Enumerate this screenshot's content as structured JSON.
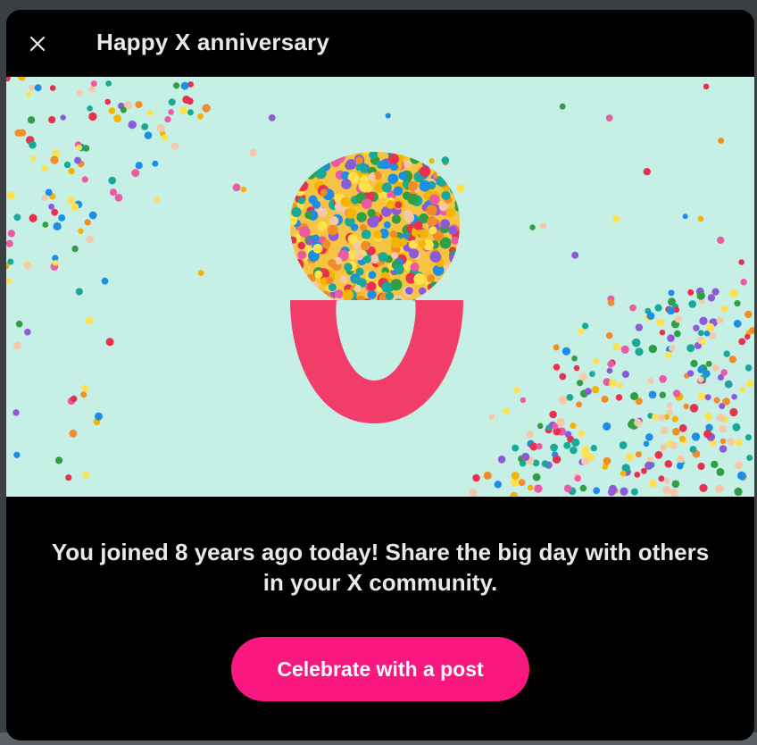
{
  "dialog": {
    "title": "Happy X anniversary",
    "close_icon": "close-icon",
    "message": "You joined 8 years ago today! Share the big day with others in your X community.",
    "cta_label": "Celebrate with a post"
  },
  "hero": {
    "image": "confetti-eight-illustration",
    "background_color": "#c6efe6",
    "accent_color": "#f23d6b"
  },
  "colors": {
    "modal_bg": "#000000",
    "text_primary": "#e7e9ea",
    "cta_bg": "#f91880",
    "cta_text": "#ffffff"
  }
}
